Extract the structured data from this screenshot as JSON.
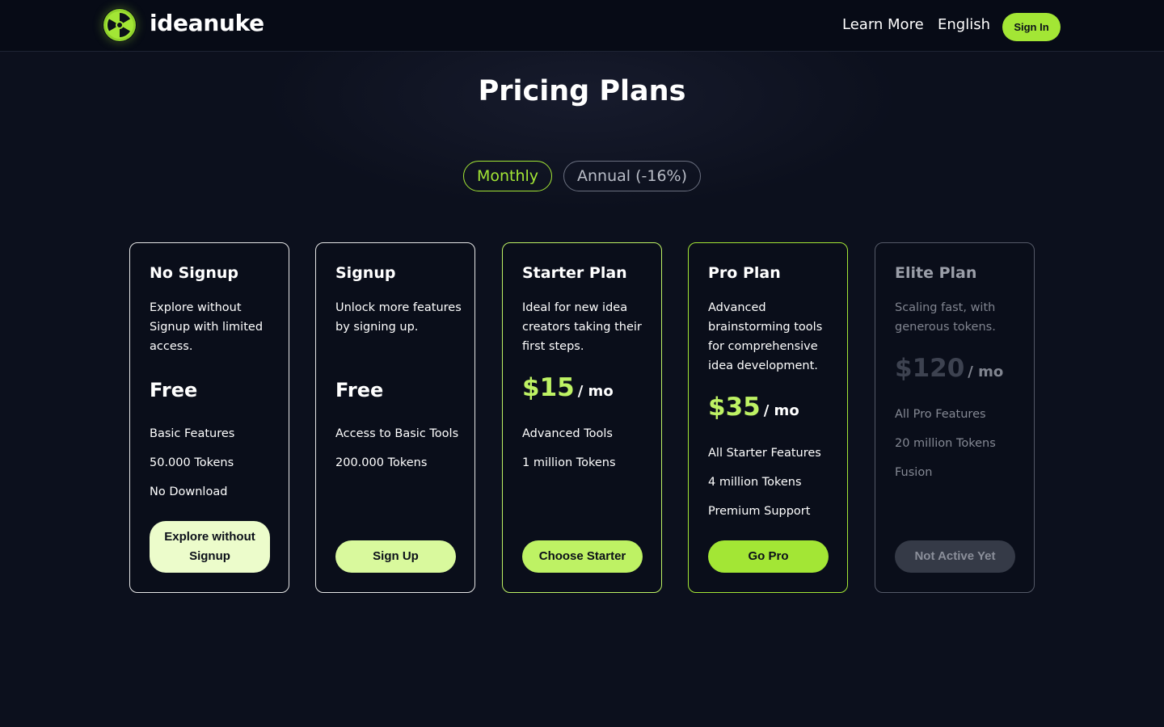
{
  "header": {
    "brand": "ideanuke",
    "nav": {
      "learn_more": "Learn More",
      "language": "English"
    },
    "sign_in": "Sign In"
  },
  "page": {
    "title": "Pricing Plans",
    "billing_toggle": {
      "monthly": "Monthly",
      "annual": "Annual (-16%)"
    }
  },
  "colors": {
    "accent": "#a3e635",
    "accent_light": "#d9f99d",
    "background": "#0c101d",
    "header_bg": "#070b16"
  },
  "plans": [
    {
      "name": "No Signup",
      "description": "Explore without Signup with limited access.",
      "price": "Free",
      "features": [
        "Basic Features",
        "50.000 Tokens",
        "No Download"
      ],
      "button": "Explore without Signup"
    },
    {
      "name": "Signup",
      "description": "Unlock more features by signing up.",
      "price": "Free",
      "features": [
        "Access to Basic Tools",
        "200.000 Tokens"
      ],
      "button": "Sign Up"
    },
    {
      "name": "Starter Plan",
      "description": "Ideal for new idea creators taking their first steps.",
      "price": "$15",
      "price_unit": "/ mo",
      "features": [
        "Advanced Tools",
        "1 million Tokens"
      ],
      "button": "Choose Starter"
    },
    {
      "name": "Pro Plan",
      "description": "Advanced brainstorming tools for comprehensive idea development.",
      "price": "$35",
      "price_unit": "/ mo",
      "features": [
        "All Starter Features",
        "4 million Tokens",
        "Premium Support"
      ],
      "button": "Go Pro"
    },
    {
      "name": "Elite Plan",
      "description": "Scaling fast, with generous tokens.",
      "price": "$120",
      "price_unit": "/ mo",
      "features": [
        "All Pro Features",
        "20 million Tokens",
        "Fusion"
      ],
      "button": "Not Active Yet"
    }
  ]
}
